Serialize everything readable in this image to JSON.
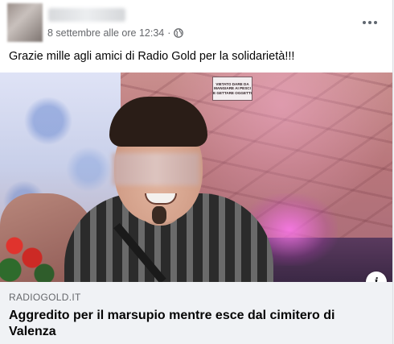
{
  "post": {
    "timestamp": "8 settembre alle ore 12:34",
    "separator": "·",
    "text": "Grazie mille agli amici di Radio Gold per la solidarietà!!!",
    "more_label": "Altro",
    "privacy_icon": "globe-icon"
  },
  "photo": {
    "sign_text": "VIETATO DARE DA\nMANGIARE AI PESCI\nE GETTARE OGGETTI"
  },
  "link": {
    "domain": "RADIOGOLD.IT",
    "title": "Aggredito per il marsupio mentre esce dal cimitero di Valenza",
    "info_glyph": "i"
  },
  "colors": {
    "background": "#f0f2f5",
    "secondary_text": "#65676b",
    "primary_text": "#050505"
  }
}
